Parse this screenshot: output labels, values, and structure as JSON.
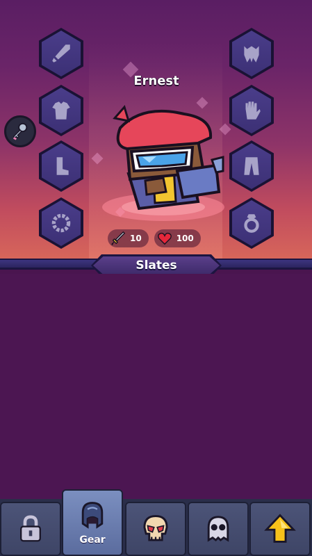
{
  "hero": {
    "name": "Ernest",
    "attack": "10",
    "health": "100"
  },
  "section": {
    "title": "Slates"
  },
  "gear_slots_left": [
    "sword-icon",
    "armor-icon",
    "boot-icon",
    "bracelet-icon"
  ],
  "gear_slots_right": [
    "helmet-icon",
    "glove-icon",
    "pants-icon",
    "ring-icon"
  ],
  "nav": {
    "items": [
      {
        "icon": "lock-icon",
        "label": ""
      },
      {
        "icon": "helmet-icon",
        "label": "Gear"
      },
      {
        "icon": "skull-icon",
        "label": ""
      },
      {
        "icon": "ghost-icon",
        "label": ""
      },
      {
        "icon": "arrow-up-icon",
        "label": ""
      }
    ]
  },
  "colors": {
    "hex_fill": "#3c3075",
    "gear_silhouette": "#a8a3c8",
    "content_bg": "#4c1652",
    "accent_yellow": "#f7c21a"
  }
}
